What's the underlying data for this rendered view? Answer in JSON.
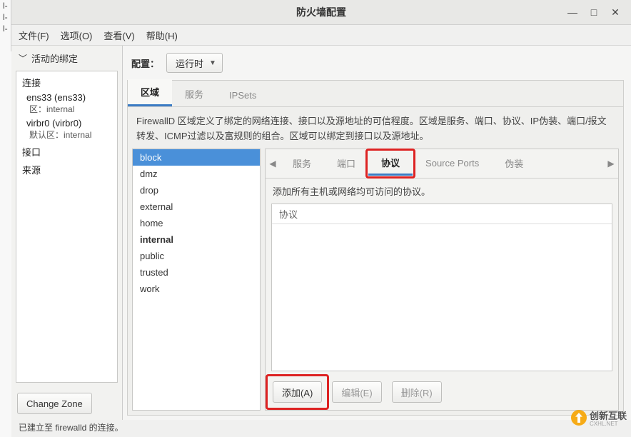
{
  "window": {
    "title": "防火墙配置"
  },
  "menubar": {
    "file": "文件(F)",
    "options": "选项(O)",
    "view": "查看(V)",
    "help": "帮助(H)"
  },
  "sidebar": {
    "header": "活动的绑定",
    "sections": {
      "conn": "连接",
      "iface": "接口",
      "source": "来源"
    },
    "conns": [
      {
        "name": "ens33 (ens33)",
        "sub": "区：internal"
      },
      {
        "name": "virbr0 (virbr0)",
        "sub": "默认区：internal"
      }
    ],
    "change_zone": "Change Zone"
  },
  "config": {
    "label": "配置：",
    "value": "运行时"
  },
  "tabs": {
    "zone": "区域",
    "service": "服务",
    "ipsets": "IPSets"
  },
  "desc": "FirewallD 区域定义了绑定的网络连接、接口以及源地址的可信程度。区域是服务、端口、协议、IP伪装、端口/报文转发、ICMP过滤以及富规则的组合。区域可以绑定到接口以及源地址。",
  "zones": [
    "block",
    "dmz",
    "drop",
    "external",
    "home",
    "internal",
    "public",
    "trusted",
    "work"
  ],
  "zone_bold": "internal",
  "subtabs": {
    "service": "服务",
    "port": "端口",
    "proto": "协议",
    "source_ports": "Source Ports",
    "masq": "伪装"
  },
  "right_desc": "添加所有主机或网络均可访问的协议。",
  "proto_header": "协议",
  "actions": {
    "add": "添加(A)",
    "edit": "编辑(E)",
    "remove": "删除(R)"
  },
  "status": "已建立至  firewalld 的连接。",
  "watermark": "创新互联"
}
